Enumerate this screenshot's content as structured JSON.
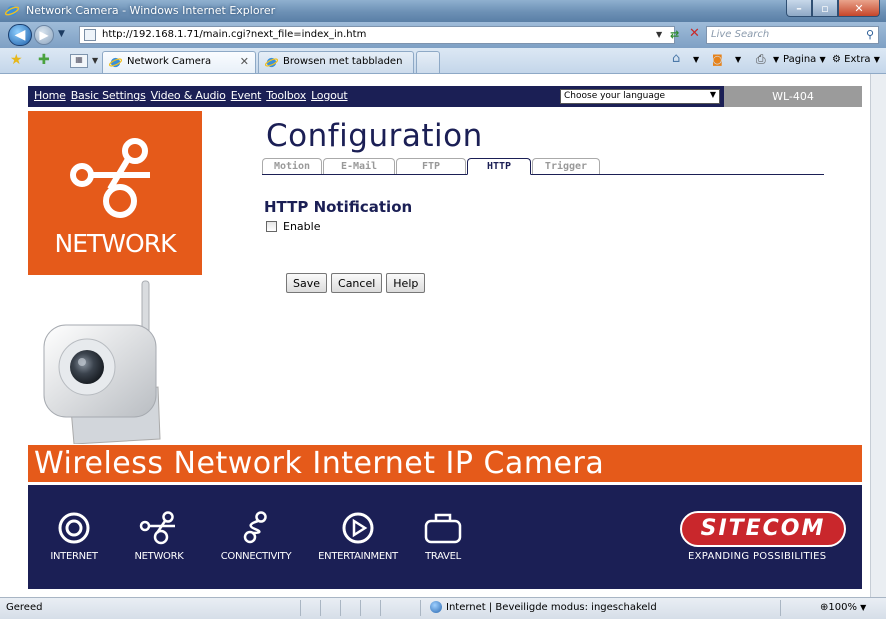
{
  "window": {
    "title": "Network Camera - Windows Internet Explorer",
    "minimize": "–",
    "maximize": "▫",
    "close": "✕"
  },
  "address": {
    "url": "http://192.168.1.71/main.cgi?next_file=index_in.htm",
    "search_placeholder": "Live Search"
  },
  "tabs": [
    {
      "label": "Network Camera"
    },
    {
      "label": "Browsen met tabbladen"
    }
  ],
  "commandbar": {
    "pagina": "Pagina",
    "extra": "Extra"
  },
  "page": {
    "nav": [
      "Home",
      "Basic Settings",
      "Video & Audio",
      "Event",
      "Toolbox",
      "Logout"
    ],
    "language": "Choose your language",
    "model": "WL-404",
    "logo_text": "NETWORK",
    "title": "Configuration",
    "config_tabs": [
      "Motion",
      "E-Mail",
      "FTP",
      "HTTP",
      "Trigger"
    ],
    "active_tab": "HTTP",
    "section_title": "HTTP Notification",
    "enable_label": "Enable",
    "enable_checked": false,
    "buttons": {
      "save": "Save",
      "cancel": "Cancel",
      "help": "Help"
    },
    "banner": "Wireless Network Internet IP Camera",
    "footer_icons": [
      "INTERNET",
      "NETWORK",
      "CONNECTIVITY",
      "ENTERTAINMENT",
      "TRAVEL"
    ],
    "brand": "SITECOM",
    "tagline": "EXPANDING POSSIBILITIES"
  },
  "status": {
    "state": "Gereed",
    "zone": "Internet | Beveiligde modus: ingeschakeld",
    "zoom": "100%"
  },
  "colors": {
    "navy": "#1b1f55",
    "orange": "#e55a1a",
    "sitecom_red": "#c9272c"
  }
}
